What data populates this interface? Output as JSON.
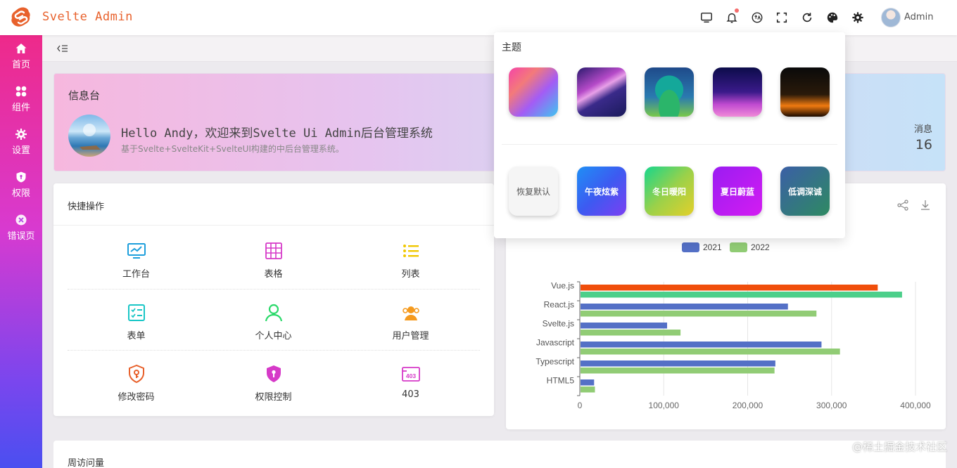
{
  "header": {
    "app_title": "Svelte Admin",
    "user_name": "Admin",
    "icons": [
      "monitor-icon",
      "bell-icon",
      "language-icon",
      "fullscreen-icon",
      "refresh-icon",
      "palette-icon",
      "settings-icon"
    ],
    "brand_color": "#e8612c"
  },
  "sidebar": {
    "items": [
      {
        "label": "首页",
        "icon": "home-icon"
      },
      {
        "label": "组件",
        "icon": "components-icon"
      },
      {
        "label": "设置",
        "icon": "gear-icon"
      },
      {
        "label": "权限",
        "icon": "shield-icon"
      },
      {
        "label": "错误页",
        "icon": "error-icon"
      }
    ]
  },
  "welcome": {
    "title": "信息台",
    "greeting": "Hello Andy，欢迎来到Svelte Ui Admin后台管理系统",
    "subtitle": "基于Svelte+SvelteKit+SvelteUI构建的中后台管理系统。",
    "messages_label": "消息",
    "messages_count": "16"
  },
  "quick_actions": {
    "title": "快捷操作",
    "items": [
      {
        "label": "工作台",
        "icon": "dashboard-icon",
        "color": "#1e9fdc"
      },
      {
        "label": "表格",
        "icon": "table-icon",
        "color": "#d63ac8"
      },
      {
        "label": "列表",
        "icon": "list-icon",
        "color": "#f0c800"
      },
      {
        "label": "表单",
        "icon": "form-icon",
        "color": "#19c6c6"
      },
      {
        "label": "个人中心",
        "icon": "user-icon",
        "color": "#2bd96a"
      },
      {
        "label": "用户管理",
        "icon": "users-icon",
        "color": "#f59a1e"
      },
      {
        "label": "修改密码",
        "icon": "lock-key-icon",
        "color": "#e8612c"
      },
      {
        "label": "权限控制",
        "icon": "shield-key-icon",
        "color": "#d63ac8"
      },
      {
        "label": "403",
        "icon": "forbidden-icon",
        "color": "#d63ac8"
      }
    ]
  },
  "theme_panel": {
    "title": "主题",
    "image_themes": [
      "gradient-theme-icon",
      "aurora-theme-icon",
      "landscape-theme-icon",
      "night-city-theme-icon",
      "dark-light-theme-icon"
    ],
    "color_themes": [
      {
        "label": "恢复默认",
        "bg": "#f5f5f5",
        "text": "#555555"
      },
      {
        "label": "午夜炫紫",
        "bg": "linear-gradient(135deg,#1f8ff5,#3d5af1,#7b3ff2)",
        "text": "#ffffff"
      },
      {
        "label": "冬日暖阳",
        "bg": "linear-gradient(135deg,#17d68c,#9ad14a,#e3d02a)",
        "text": "#ffffff"
      },
      {
        "label": "夏日蔚蓝",
        "bg": "linear-gradient(135deg,#9b1cf2,#d31cf2)",
        "text": "#ffffff"
      },
      {
        "label": "低调深诚",
        "bg": "linear-gradient(135deg,#3b5fa6,#2e8a62)",
        "text": "#ffffff"
      }
    ]
  },
  "chart_data": {
    "type": "bar",
    "orientation": "horizontal",
    "categories": [
      "Vue.js",
      "React.js",
      "Svelte.js",
      "Javascript",
      "Typescript",
      "HTML5"
    ],
    "series": [
      {
        "name": "2021",
        "values": [
          355000,
          248000,
          104000,
          288000,
          233000,
          17000
        ],
        "color": "#5470c6",
        "overrides": {
          "Vue.js": "#f04e0b"
        }
      },
      {
        "name": "2022",
        "values": [
          384000,
          282000,
          120000,
          310000,
          232000,
          18000
        ],
        "color": "#91cc75",
        "overrides": {
          "Vue.js": "#4ccf8a"
        }
      }
    ],
    "xlim": [
      0,
      400000
    ],
    "xticks": [
      "0",
      "100,000",
      "200,000",
      "300,000",
      "400,000"
    ],
    "legend_position": "top-center",
    "grid": true
  },
  "weekly": {
    "title": "周访问量"
  },
  "watermark": "@稀土掘金技术社区"
}
